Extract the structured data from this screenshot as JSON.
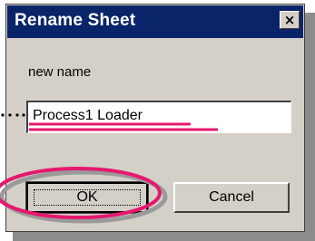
{
  "dialog": {
    "title": "Rename Sheet",
    "close_glyph": "×",
    "field_label": "new name",
    "field_value": "Process1 Loader",
    "ok_label": "OK",
    "cancel_label": "Cancel"
  },
  "colors": {
    "titlebar": "#0a246a",
    "face": "#d4d0c8",
    "highlight": "#e5186e"
  },
  "icons": {
    "close": "close-icon"
  }
}
